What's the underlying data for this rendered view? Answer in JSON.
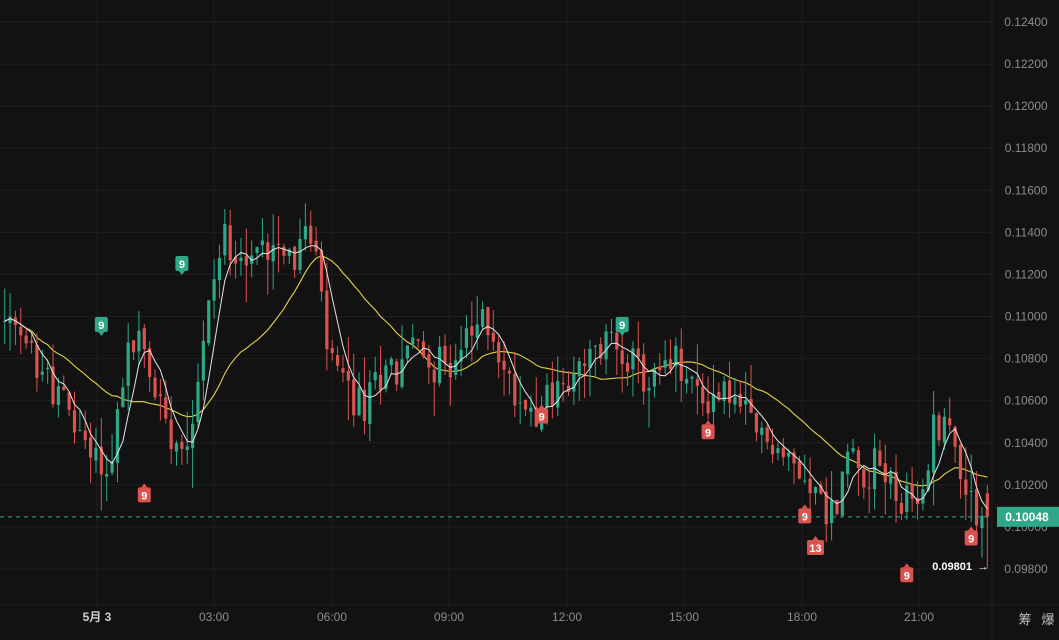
{
  "chart_data": {
    "type": "candlestick",
    "x_tick_labels": [
      "5月 3",
      "03:00",
      "06:00",
      "09:00",
      "12:00",
      "15:00",
      "18:00",
      "21:00"
    ],
    "y_tick_labels": [
      "0.12400",
      "0.12200",
      "0.12000",
      "0.11800",
      "0.11600",
      "0.11400",
      "0.11200",
      "0.11000",
      "0.10800",
      "0.10600",
      "0.10400",
      "0.10200",
      "0.10000",
      "0.09800"
    ],
    "ylim": [
      0.0972,
      0.1255
    ],
    "grid": true,
    "current_price": "0.10048",
    "low_label": "0.09801",
    "corner_labels": [
      "筹",
      "爆"
    ],
    "colors": {
      "up": "#2ea888",
      "down": "#d9534f",
      "ma_fast": "#e6e6e6",
      "ma_slow": "#e3d44a",
      "price_tag": "#2ea888",
      "grid": "#1f1f1f"
    },
    "price_path": [
      {
        "t": 0,
        "p": 0.1098
      },
      {
        "t": 6,
        "p": 0.1082
      },
      {
        "t": 11,
        "p": 0.1063
      },
      {
        "t": 15,
        "p": 0.1044
      },
      {
        "t": 18,
        "p": 0.1035
      },
      {
        "t": 20,
        "p": 0.1024
      },
      {
        "t": 22,
        "p": 0.1052
      },
      {
        "t": 24,
        "p": 0.1083
      },
      {
        "t": 26,
        "p": 0.109
      },
      {
        "t": 28,
        "p": 0.1072
      },
      {
        "t": 31,
        "p": 0.1052
      },
      {
        "t": 34,
        "p": 0.104
      },
      {
        "t": 36,
        "p": 0.1055
      },
      {
        "t": 38,
        "p": 0.1088
      },
      {
        "t": 40,
        "p": 0.112
      },
      {
        "t": 42,
        "p": 0.1138
      },
      {
        "t": 44,
        "p": 0.1136
      },
      {
        "t": 46,
        "p": 0.1125
      },
      {
        "t": 49,
        "p": 0.1133
      },
      {
        "t": 52,
        "p": 0.114
      },
      {
        "t": 55,
        "p": 0.1128
      },
      {
        "t": 57,
        "p": 0.114
      },
      {
        "t": 59,
        "p": 0.1128
      },
      {
        "t": 61,
        "p": 0.1085
      },
      {
        "t": 63,
        "p": 0.1073
      },
      {
        "t": 66,
        "p": 0.106
      },
      {
        "t": 68,
        "p": 0.1057
      },
      {
        "t": 70,
        "p": 0.1067
      },
      {
        "t": 72,
        "p": 0.1082
      },
      {
        "t": 74,
        "p": 0.1072
      },
      {
        "t": 76,
        "p": 0.1088
      },
      {
        "t": 79,
        "p": 0.1082
      },
      {
        "t": 82,
        "p": 0.1076
      },
      {
        "t": 85,
        "p": 0.1082
      },
      {
        "t": 88,
        "p": 0.109
      },
      {
        "t": 90,
        "p": 0.1098
      },
      {
        "t": 92,
        "p": 0.1092
      },
      {
        "t": 94,
        "p": 0.1072
      },
      {
        "t": 97,
        "p": 0.106
      },
      {
        "t": 100,
        "p": 0.1058
      },
      {
        "t": 103,
        "p": 0.1064
      },
      {
        "t": 106,
        "p": 0.1066
      },
      {
        "t": 108,
        "p": 0.1072
      },
      {
        "t": 110,
        "p": 0.1078
      },
      {
        "t": 112,
        "p": 0.1085
      },
      {
        "t": 114,
        "p": 0.1091
      },
      {
        "t": 117,
        "p": 0.1082
      },
      {
        "t": 120,
        "p": 0.1068
      },
      {
        "t": 123,
        "p": 0.1072
      },
      {
        "t": 126,
        "p": 0.1078
      },
      {
        "t": 129,
        "p": 0.1066
      },
      {
        "t": 132,
        "p": 0.106
      },
      {
        "t": 135,
        "p": 0.1066
      },
      {
        "t": 138,
        "p": 0.1055
      },
      {
        "t": 141,
        "p": 0.1045
      },
      {
        "t": 144,
        "p": 0.104
      },
      {
        "t": 147,
        "p": 0.103
      },
      {
        "t": 150,
        "p": 0.1026
      },
      {
        "t": 152,
        "p": 0.1018
      },
      {
        "t": 154,
        "p": 0.1006
      },
      {
        "t": 156,
        "p": 0.101
      },
      {
        "t": 158,
        "p": 0.1035
      },
      {
        "t": 160,
        "p": 0.1032
      },
      {
        "t": 162,
        "p": 0.1025
      },
      {
        "t": 164,
        "p": 0.103
      },
      {
        "t": 166,
        "p": 0.1022
      },
      {
        "t": 168,
        "p": 0.1012
      },
      {
        "t": 170,
        "p": 0.1008
      },
      {
        "t": 172,
        "p": 0.1015
      },
      {
        "t": 174,
        "p": 0.1048
      },
      {
        "t": 176,
        "p": 0.1052
      },
      {
        "t": 178,
        "p": 0.1038
      },
      {
        "t": 180,
        "p": 0.102
      },
      {
        "t": 182,
        "p": 0.101
      },
      {
        "t": 183,
        "p": 0.1004
      }
    ],
    "markers": [
      {
        "label": "9",
        "type": "up",
        "t": 33,
        "price": 0.1125
      },
      {
        "label": "9",
        "type": "up",
        "t": 18,
        "price": 0.1096
      },
      {
        "label": "9",
        "type": "down",
        "t": 26,
        "price": 0.1015
      },
      {
        "label": "9",
        "type": "down",
        "t": 100,
        "price": 0.10525
      },
      {
        "label": "9",
        "type": "up",
        "t": 115,
        "price": 0.1096
      },
      {
        "label": "9",
        "type": "down",
        "t": 131,
        "price": 0.1045
      },
      {
        "label": "9",
        "type": "down",
        "t": 149,
        "price": 0.1005
      },
      {
        "label": "13",
        "type": "down",
        "t": 151,
        "price": 0.099
      },
      {
        "label": "9",
        "type": "down",
        "t": 168,
        "price": 0.0977
      },
      {
        "label": "9",
        "type": "down",
        "t": 180,
        "price": 0.09945
      }
    ]
  }
}
